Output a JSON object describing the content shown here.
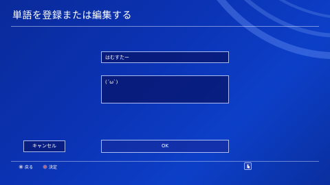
{
  "header": {
    "title": "単語を登録または編集する"
  },
  "form": {
    "word_value": "はむすたー",
    "reading_value": "(´ω`)"
  },
  "buttons": {
    "cancel_label": "キャンセル",
    "ok_label": "OK"
  },
  "footer": {
    "back_label": "戻る",
    "back_icon": "cross-button-icon",
    "enter_label": "決定",
    "enter_icon": "circle-button-icon",
    "touchpad_icon": "touchpad-icon"
  },
  "colors": {
    "background": "#0b33b4",
    "field_fill": "#08166e",
    "border": "#c8d7ff",
    "text": "#ffffff"
  }
}
